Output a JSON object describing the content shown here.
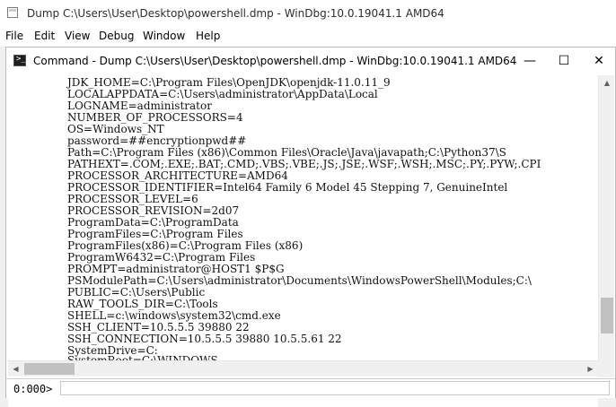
{
  "app": {
    "title": "Dump C:\\Users\\User\\Desktop\\powershell.dmp - WinDbg:10.0.19041.1 AMD64"
  },
  "menu": [
    "File",
    "Edit",
    "View",
    "Debug",
    "Window",
    "Help"
  ],
  "command_window": {
    "title": "Command - Dump C:\\Users\\User\\Desktop\\powershell.dmp - WinDbg:10.0.19041.1 AMD64",
    "controls": {
      "minimize": "—",
      "maximize": "☐",
      "close": "✕"
    },
    "output_lines": [
      "JDK_HOME=C:\\Program Files\\OpenJDK\\openjdk-11.0.11_9",
      "LOCALAPPDATA=C:\\Users\\administrator\\AppData\\Local",
      "LOGNAME=administrator",
      "NUMBER_OF_PROCESSORS=4",
      "OS=Windows_NT",
      "password=##encryptionpwd##",
      "Path=C:\\Program Files (x86)\\Common Files\\Oracle\\Java\\javapath;C:\\Python37\\S",
      "PATHEXT=.COM;.EXE;.BAT;.CMD;.VBS;.VBE;.JS;.JSE;.WSF;.WSH;.MSC;.PY;.PYW;.CPI",
      "PROCESSOR_ARCHITECTURE=AMD64",
      "PROCESSOR_IDENTIFIER=Intel64 Family 6 Model 45 Stepping 7, GenuineIntel",
      "PROCESSOR_LEVEL=6",
      "PROCESSOR_REVISION=2d07",
      "ProgramData=C:\\ProgramData",
      "ProgramFiles=C:\\Program Files",
      "ProgramFiles(x86)=C:\\Program Files (x86)",
      "ProgramW6432=C:\\Program Files",
      "PROMPT=administrator@HOST1 $P$G",
      "PSModulePath=C:\\Users\\administrator\\Documents\\WindowsPowerShell\\Modules;C:\\",
      "PUBLIC=C:\\Users\\Public",
      "RAW_TOOLS_DIR=C:\\Tools",
      "SHELL=c:\\windows\\system32\\cmd.exe",
      "SSH_CLIENT=10.5.5.5 39880 22",
      "SSH_CONNECTION=10.5.5.5 39880 10.5.5.61 22",
      "SystemDrive=C:",
      "SystemRoot=C:\\WINDOWS"
    ],
    "prompt": "0:000>",
    "input_value": ""
  }
}
